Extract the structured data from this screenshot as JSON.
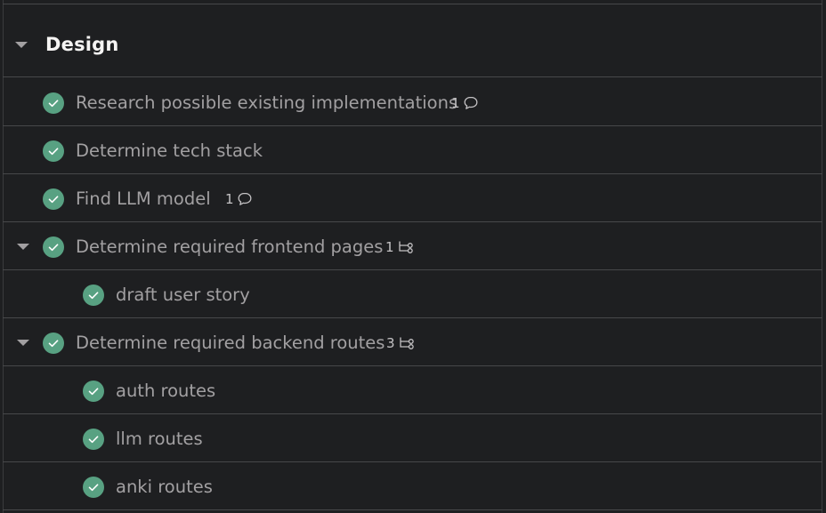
{
  "section": {
    "title": "Design",
    "caret_icon": "caret-down-icon"
  },
  "tasks": [
    {
      "label": "Research possible existing implementations",
      "completed": true,
      "meta_count": "1",
      "meta_icon": "comment-icon"
    },
    {
      "label": "Determine tech stack",
      "completed": true
    },
    {
      "label": "Find LLM model",
      "completed": true,
      "meta_count": "1",
      "meta_icon": "comment-icon"
    },
    {
      "label": "Determine required frontend pages",
      "completed": true,
      "expanded": true,
      "meta_count": "1",
      "meta_icon": "subtask-icon"
    },
    {
      "label": "draft user story",
      "completed": true,
      "subtask": true
    },
    {
      "label": "Determine required backend routes",
      "completed": true,
      "expanded": true,
      "meta_count": "3",
      "meta_icon": "subtask-icon"
    },
    {
      "label": "auth routes",
      "completed": true,
      "subtask": true
    },
    {
      "label": "llm routes",
      "completed": true,
      "subtask": true
    },
    {
      "label": "anki routes",
      "completed": true,
      "subtask": true
    }
  ],
  "colors": {
    "background": "#1e1f21",
    "check_fill": "#58a182",
    "task_text": "#a2a0a2",
    "title_text": "#f5f4f3",
    "divider": "#47484a"
  }
}
